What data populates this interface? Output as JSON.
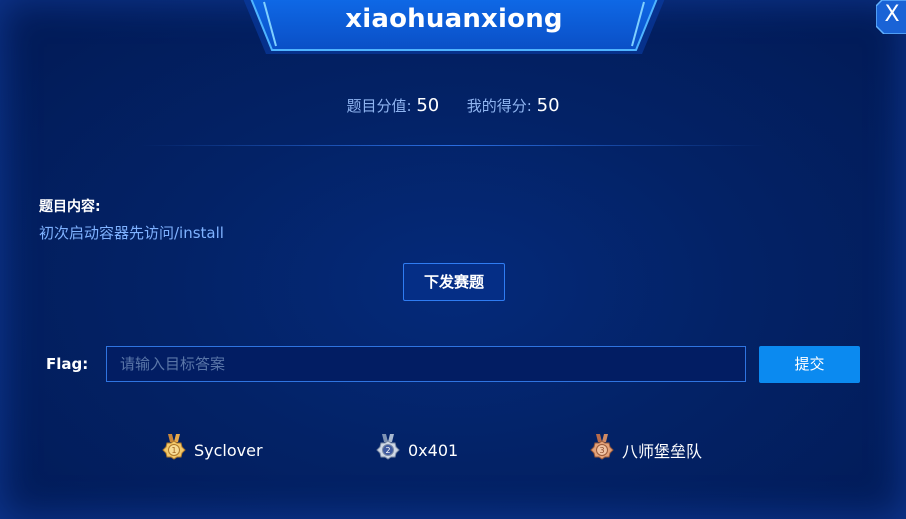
{
  "dialog": {
    "title": "xiaohuanxiong",
    "close_label": "X"
  },
  "score": {
    "value_label": "题目分值:",
    "value": "50",
    "my_label": "我的得分:",
    "my_value": "50"
  },
  "challenge": {
    "content_label": "题目内容:",
    "content_text": "初次启动容器先访问/install",
    "issue_button": "下发赛题"
  },
  "flag": {
    "label": "Flag:",
    "placeholder": "请输入目标答案",
    "value": "",
    "submit_label": "提交"
  },
  "rankings": [
    {
      "rank": "1",
      "team": "Syclover",
      "medal_icon": "gold-medal-icon"
    },
    {
      "rank": "2",
      "team": "0x401",
      "medal_icon": "silver-medal-icon"
    },
    {
      "rank": "3",
      "team": "八师堡垒队",
      "medal_icon": "bronze-medal-icon"
    }
  ],
  "colors": {
    "background": "#032266",
    "accent": "#0b8af0",
    "link_text": "#7fb2ff",
    "gold": "#f2c86a",
    "silver": "#cfd8e6",
    "bronze": "#e3a27a"
  }
}
